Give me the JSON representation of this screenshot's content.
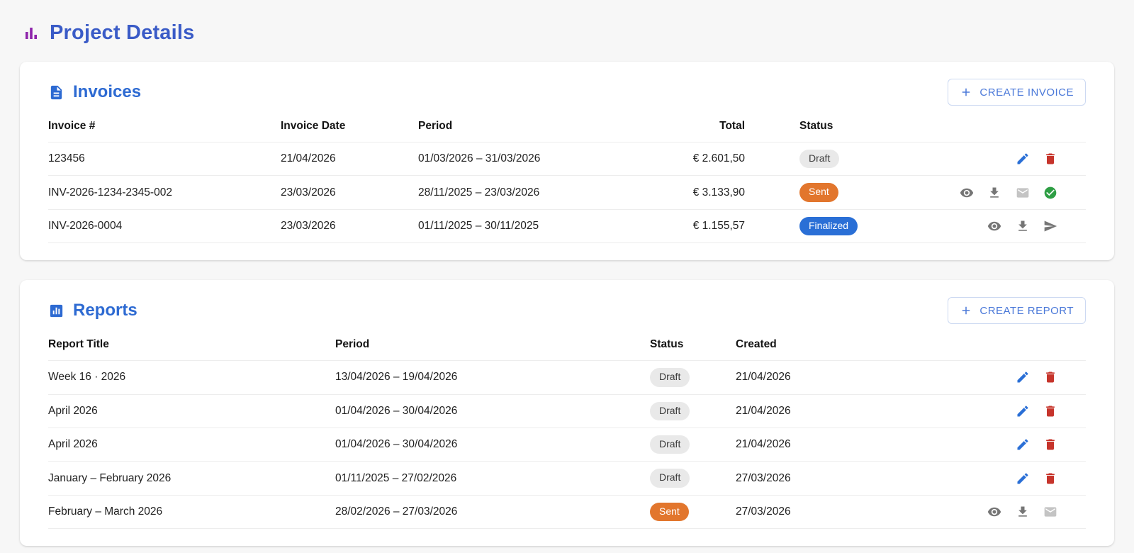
{
  "page": {
    "title": "Project Details"
  },
  "colors": {
    "title_blue": "#3a5bc7",
    "section_blue": "#2d6ad2",
    "button_blue": "#4b79d9",
    "title_icon_purple": "#8e24aa",
    "edit_blue": "#2a6fd6",
    "delete_red": "#c6342b",
    "icon_gray": "#757575",
    "icon_light_gray": "#c4c4c4",
    "check_green": "#2e9e44",
    "badge_draft_bg": "#e9e9e9",
    "badge_sent_bg": "#e2762d",
    "badge_finalized_bg": "#2a6fd6"
  },
  "icons": {
    "title": "bar-chart-icon",
    "invoices": "document-icon",
    "reports": "chart-box-icon",
    "create": "plus-icon",
    "edit": "pencil-icon",
    "delete": "trash-icon",
    "view": "eye-icon",
    "download": "download-icon",
    "email": "envelope-icon",
    "paid": "check-circle-icon",
    "send": "paper-plane-icon"
  },
  "invoices": {
    "title": "Invoices",
    "create_button": "CREATE INVOICE",
    "columns": [
      "Invoice #",
      "Invoice Date",
      "Period",
      "Total",
      "Status"
    ],
    "rows": [
      {
        "number": "123456",
        "date": "21/04/2026",
        "period": "01/03/2026 – 31/03/2026",
        "total": "€ 2.601,50",
        "status": "Draft",
        "actions": [
          "edit",
          "delete"
        ]
      },
      {
        "number": "INV-2026-1234-2345-002",
        "date": "23/03/2026",
        "period": "28/11/2025 – 23/03/2026",
        "total": "€ 3.133,90",
        "status": "Sent",
        "actions": [
          "view",
          "download",
          "email",
          "paid"
        ]
      },
      {
        "number": "INV-2026-0004",
        "date": "23/03/2026",
        "period": "01/11/2025 – 30/11/2025",
        "total": "€ 1.155,57",
        "status": "Finalized",
        "actions": [
          "view",
          "download",
          "send"
        ]
      }
    ]
  },
  "reports": {
    "title": "Reports",
    "create_button": "CREATE REPORT",
    "columns": [
      "Report Title",
      "Period",
      "Status",
      "Created"
    ],
    "rows": [
      {
        "title": "Week 16 · 2026",
        "period": "13/04/2026 – 19/04/2026",
        "status": "Draft",
        "created": "21/04/2026",
        "actions": [
          "edit",
          "delete"
        ]
      },
      {
        "title": "April 2026",
        "period": "01/04/2026 – 30/04/2026",
        "status": "Draft",
        "created": "21/04/2026",
        "actions": [
          "edit",
          "delete"
        ]
      },
      {
        "title": "April 2026",
        "period": "01/04/2026 – 30/04/2026",
        "status": "Draft",
        "created": "21/04/2026",
        "actions": [
          "edit",
          "delete"
        ]
      },
      {
        "title": "January – February 2026",
        "period": "01/11/2025 – 27/02/2026",
        "status": "Draft",
        "created": "27/03/2026",
        "actions": [
          "edit",
          "delete"
        ]
      },
      {
        "title": "February – March 2026",
        "period": "28/02/2026 – 27/03/2026",
        "status": "Sent",
        "created": "27/03/2026",
        "actions": [
          "view",
          "download",
          "email"
        ]
      }
    ]
  }
}
